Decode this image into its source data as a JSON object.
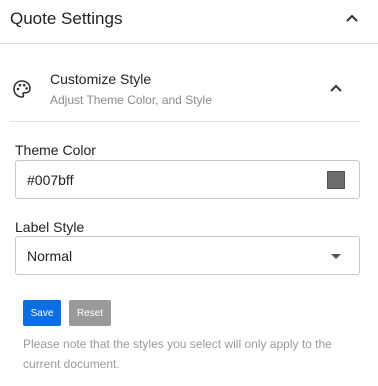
{
  "header": {
    "title": "Quote Settings",
    "collapse_icon": "chevron-up-icon"
  },
  "customize": {
    "icon": "palette-icon",
    "title": "Customize Style",
    "subtitle": "Adjust Theme Color, and Style",
    "collapse_icon": "chevron-up-icon"
  },
  "theme_color": {
    "label": "Theme Color",
    "value": "#007bff",
    "swatch_color": "#6d6d6d"
  },
  "label_style": {
    "label": "Label Style",
    "selected": "Normal"
  },
  "buttons": {
    "save": "Save",
    "reset": "Reset"
  },
  "colors": {
    "primary": "#0b6fe3",
    "secondary": "#9a9a9a"
  },
  "note": "Please note that the styles you select will only apply to the current document."
}
